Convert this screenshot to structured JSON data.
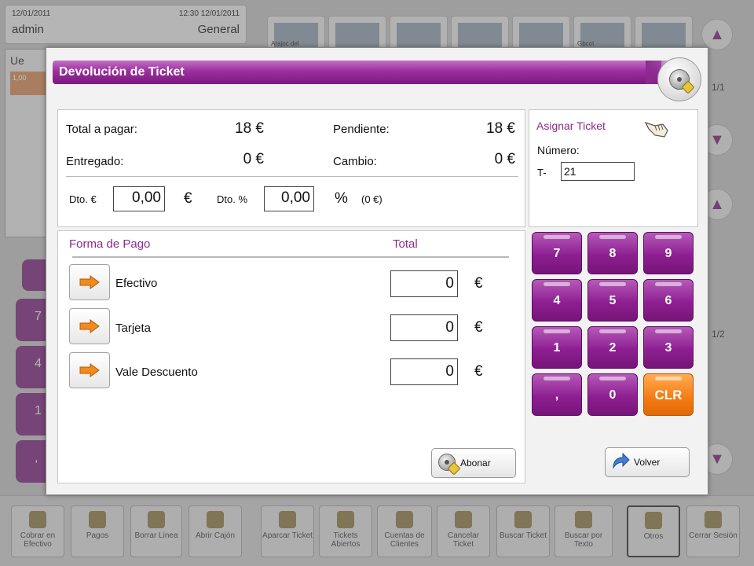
{
  "background": {
    "header": {
      "date_left": "12/01/2011",
      "date_right": "12:30 12/01/2011",
      "user": "admin",
      "location": "General"
    },
    "lines": {
      "toolbar_glyph": "Ue",
      "first_row": "1,00"
    },
    "pad_digits": [
      "7",
      "4",
      "1",
      ","
    ],
    "products": [
      "Arajoc del",
      "",
      "",
      "",
      "",
      "Gbcot",
      ""
    ],
    "page_top": "1/1",
    "page_bottom": "1/2",
    "toolbar": [
      {
        "label": "Cobrar en Efectivo",
        "icon": "coins-icon"
      },
      {
        "label": "Pagos",
        "icon": "card-icon"
      },
      {
        "label": "Borrar Linea",
        "icon": "delete-line-icon"
      },
      {
        "label": "Abrir Cajón",
        "icon": "drawer-icon"
      },
      {
        "label": "Aparcar Ticket",
        "icon": "park-ticket-icon"
      },
      {
        "label": "Tickets Abiertos",
        "icon": "open-tickets-icon"
      },
      {
        "label": "Cuentas de Clientes",
        "icon": "accounts-icon"
      },
      {
        "label": "Cancelar Ticket",
        "icon": "cancel-ticket-icon"
      },
      {
        "label": "Buscar Ticket",
        "icon": "search-ticket-icon"
      },
      {
        "label": "Buscar por Texto",
        "icon": "search-text-icon"
      },
      {
        "label": "Otros",
        "icon": "gears-icon"
      },
      {
        "label": "Cerrar Sesión",
        "icon": "logout-icon"
      }
    ]
  },
  "dialog": {
    "title": "Devolución de Ticket",
    "summary": {
      "total_label": "Total a pagar:",
      "total_value": "18 €",
      "pending_label": "Pendiente:",
      "pending_value": "18 €",
      "delivered_label": "Entregado:",
      "delivered_value": "0 €",
      "change_label": "Cambio:",
      "change_value": "0 €",
      "discount_eur_label": "Dto. €",
      "discount_eur_value": "0,00",
      "eur_symbol": "€",
      "discount_pct_label": "Dto. %",
      "discount_pct_value": "0,00",
      "pct_symbol": "%",
      "discount_amount": "(0 €)"
    },
    "assign": {
      "title": "Asignar Ticket",
      "number_label": "Número:",
      "prefix": "T-",
      "number_value": "21"
    },
    "payments": {
      "method_header": "Forma de Pago",
      "total_header": "Total",
      "currency": "€",
      "methods": [
        {
          "label": "Efectivo",
          "amount": "0"
        },
        {
          "label": "Tarjeta",
          "amount": "0"
        },
        {
          "label": "Vale Descuento",
          "amount": "0"
        }
      ]
    },
    "keypad": [
      "7",
      "8",
      "9",
      "4",
      "5",
      "6",
      "1",
      "2",
      "3",
      ",",
      "0",
      "CLR"
    ],
    "buttons": {
      "refund": "Abonar",
      "back": "Volver"
    },
    "colors": {
      "accent": "#8e1f92",
      "clear_key": "#f47a12",
      "arrow": "#f28a1e"
    }
  }
}
